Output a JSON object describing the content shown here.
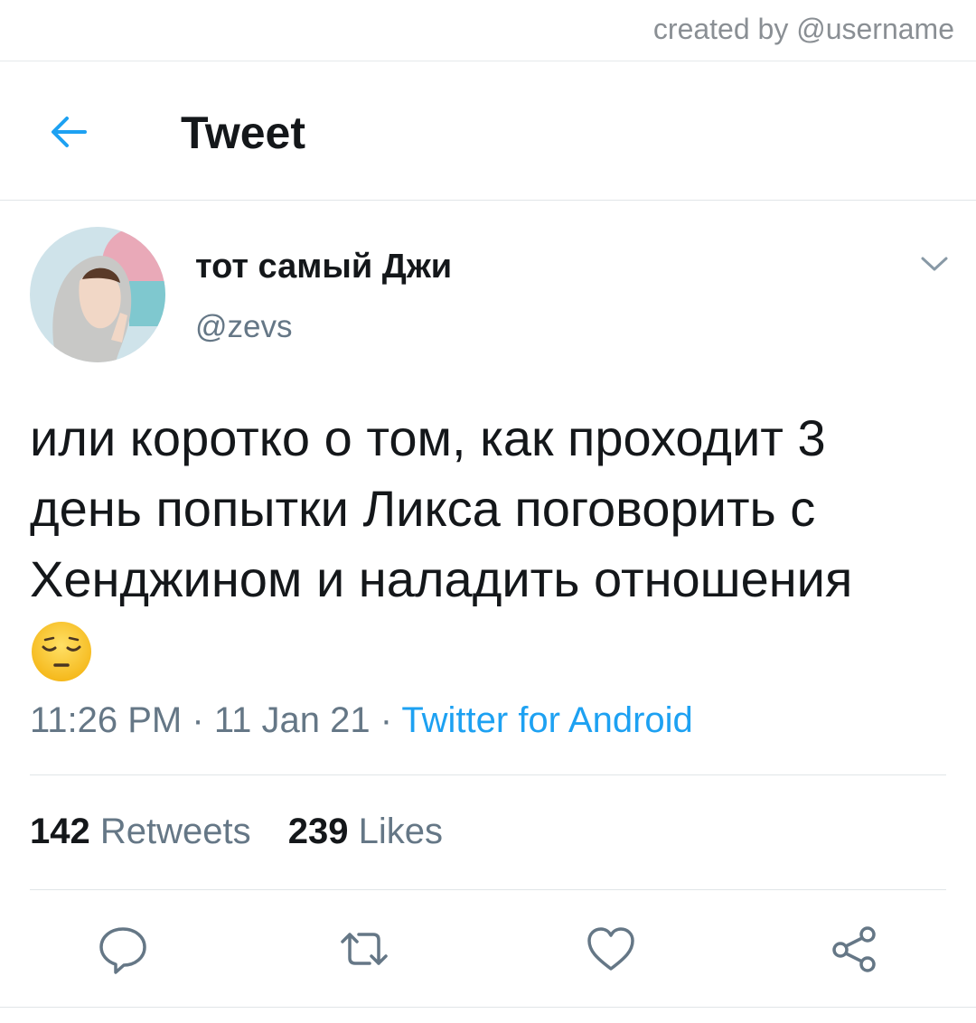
{
  "watermark": {
    "text": "created by @username"
  },
  "header": {
    "title": "Tweet",
    "back_icon": "arrow-left-icon"
  },
  "colors": {
    "accent": "#1da1f2",
    "muted": "#657786",
    "text": "#14171a",
    "divider": "#e1e5e8"
  },
  "tweet": {
    "author": {
      "display_name": "тот самый Джи",
      "handle": "@zevs"
    },
    "text_lines": [
      "или коротко о том, как проходит 3",
      "день попытки Ликса поговорить с",
      "Хенджином и наладить отношения"
    ],
    "emoji": "pensive-face-emoji",
    "time": "11:26 PM",
    "date": "11 Jan 21",
    "separator": "·",
    "source": "Twitter for Android",
    "stats": {
      "retweets_count": "142",
      "retweets_label": "Retweets",
      "likes_count": "239",
      "likes_label": "Likes"
    }
  },
  "actions": [
    {
      "icon": "reply-icon"
    },
    {
      "icon": "retweet-icon"
    },
    {
      "icon": "heart-icon"
    },
    {
      "icon": "share-icon"
    }
  ]
}
